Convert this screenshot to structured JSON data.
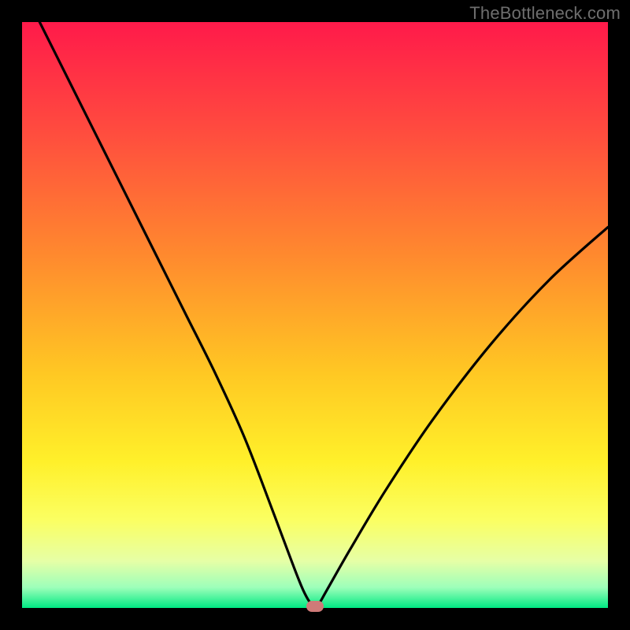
{
  "watermark": "TheBottleneck.com",
  "chart_data": {
    "type": "line",
    "title": "",
    "xlabel": "",
    "ylabel": "",
    "xlim": [
      0,
      100
    ],
    "ylim": [
      0,
      100
    ],
    "x": [
      3,
      8,
      13,
      18,
      23,
      28,
      33,
      38,
      43,
      46,
      48,
      49.5,
      50.5,
      52,
      56,
      62,
      70,
      80,
      90,
      100
    ],
    "values": [
      100,
      90,
      80,
      70,
      60,
      50,
      40,
      29,
      16,
      8,
      3,
      0.5,
      0.5,
      3,
      10,
      20,
      32,
      45,
      56,
      65
    ],
    "marker": {
      "x": 50,
      "y": 0.3,
      "color": "#cf7a78"
    },
    "gradient_stops": [
      {
        "pct": 0,
        "color": "#ff1a4a"
      },
      {
        "pct": 18,
        "color": "#ff4a3f"
      },
      {
        "pct": 40,
        "color": "#ff8a2e"
      },
      {
        "pct": 60,
        "color": "#ffc823"
      },
      {
        "pct": 75,
        "color": "#fff02a"
      },
      {
        "pct": 85,
        "color": "#fbff62"
      },
      {
        "pct": 92,
        "color": "#e6ffa6"
      },
      {
        "pct": 96.5,
        "color": "#9dffba"
      },
      {
        "pct": 100,
        "color": "#00e882"
      }
    ],
    "curve_color": "#000000",
    "curve_width": 3.2
  }
}
